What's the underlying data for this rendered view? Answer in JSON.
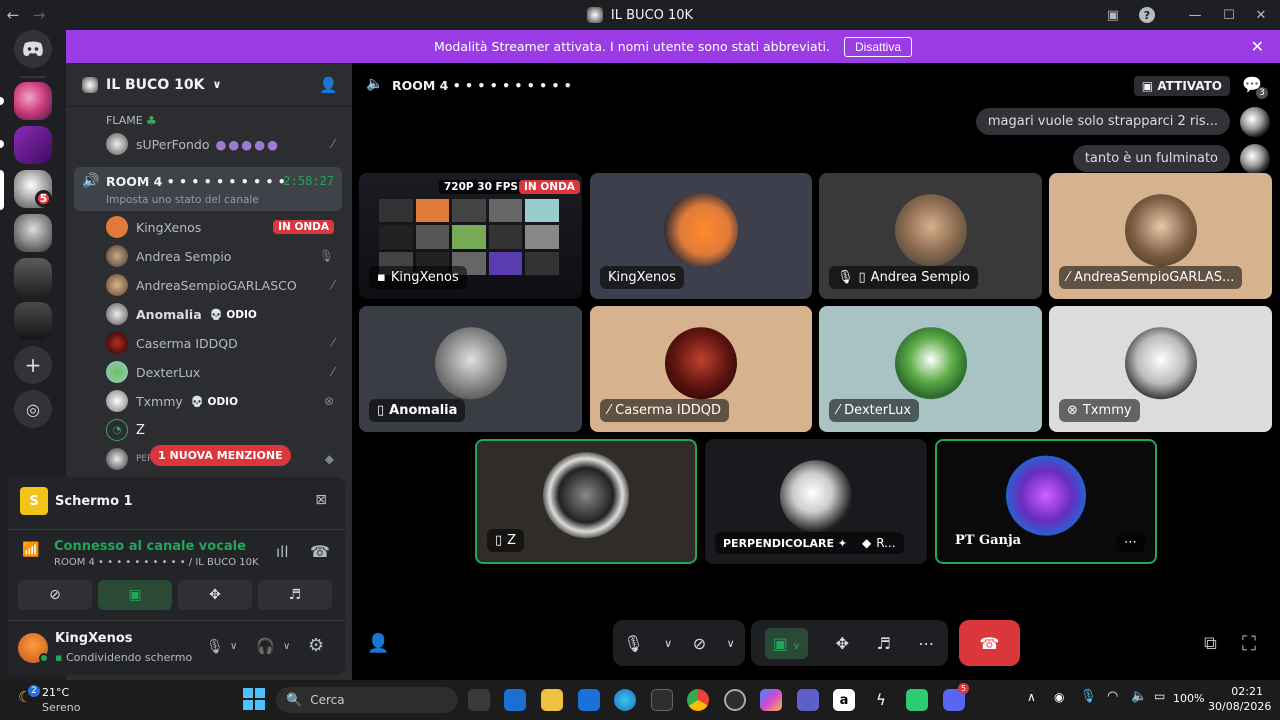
{
  "window": {
    "title": "IL BUCO 10K"
  },
  "banner": {
    "text": "Modalità Streamer attivata. I nomi utente sono stati abbreviati.",
    "button": "Disattiva"
  },
  "guilds": {
    "badge": "5"
  },
  "server": {
    "name": "IL BUCO 10K"
  },
  "channels": {
    "prev_group": "FLAME",
    "prev_user": "sUPerFondo",
    "room": {
      "name": "ROOM 4 • • • • • • • • • •",
      "timer": "2:58:27",
      "status_placeholder": "Imposta uno stato del canale"
    },
    "users": [
      {
        "name": "KingXenos",
        "badge": "IN ONDA"
      },
      {
        "name": "Andrea Sempio",
        "badge": ""
      },
      {
        "name": "AndreaSempioGARLASCO",
        "badge": ""
      },
      {
        "name": "Anomalia",
        "badge": "ODIO"
      },
      {
        "name": "Caserma IDDQD",
        "badge": ""
      },
      {
        "name": "DexterLux",
        "badge": ""
      },
      {
        "name": "Txmmy",
        "badge": "ODIO"
      },
      {
        "name": "Z",
        "badge": ""
      },
      {
        "name": "PERPENDICOLARE",
        "badge": ""
      }
    ],
    "mention_pill": "1 NUOVA MENZIONE"
  },
  "panel": {
    "screen_title": "Schermo 1",
    "voice_status": "Connesso al canale vocale",
    "voice_location": "ROOM 4 • • • • • • • • • • / IL BUCO 10K",
    "user_name": "KingXenos",
    "user_status": "Condividendo schermo"
  },
  "stage": {
    "channel": "ROOM 4 • • • • • • • • • •",
    "activated": "ATTIVATO",
    "viewer_count": "3",
    "messages": [
      "magari vuole solo strapparci 2 ris...",
      "tanto è un fulminato"
    ],
    "stream_quality": "720P 30 FPS",
    "stream_live": "IN ONDA",
    "tiles": [
      {
        "name": "KingXenos"
      },
      {
        "name": "KingXenos"
      },
      {
        "name": "Andrea Sempio"
      },
      {
        "name": "AndreaSempioGARLAS..."
      },
      {
        "name": "Anomalia"
      },
      {
        "name": "Caserma IDDQD"
      },
      {
        "name": "DexterLux"
      },
      {
        "name": "Txmmy"
      },
      {
        "name": "Z"
      },
      {
        "name": "PERPENDICOLARE ✦",
        "extra": "R..."
      },
      {
        "name": "PT Ganja"
      }
    ]
  },
  "taskbar": {
    "weather_temp": "21°C",
    "weather_desc": "Sereno",
    "weather_badge": "2",
    "search_placeholder": "Cerca",
    "battery": "100%",
    "time": "02:21",
    "date": "30/08/2026",
    "discord_badge": "5"
  },
  "colors": {
    "accent": "#9b3be6",
    "voice_green": "#23a55a",
    "live_red": "#da373c",
    "hangup": "#da373c"
  }
}
